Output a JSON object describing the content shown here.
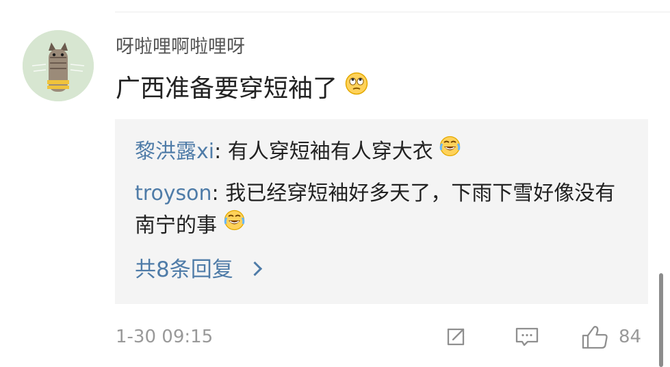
{
  "post": {
    "username": "呀啦哩啊啦哩呀",
    "text": "广西准备要穿短袖了",
    "text_emoji": "rolling-eyes-emoji",
    "timestamp": "1-30 09:15"
  },
  "replies": [
    {
      "user": "黎洪露xi",
      "separator": ": ",
      "text": "有人穿短袖有人穿大衣",
      "emoji": "laughing-tears-emoji"
    },
    {
      "user": "troyson",
      "separator": ": ",
      "text": "我已经穿短袖好多天了，下雨下雪好像没有南宁的事",
      "emoji": "laughing-tears-emoji"
    }
  ],
  "reply_summary": {
    "label": "共8条回复"
  },
  "actions": {
    "share_icon": "share-icon",
    "comment_icon": "comment-icon",
    "like_icon": "thumbs-up-icon",
    "like_count": "84"
  },
  "colors": {
    "link_blue": "#4f7ca8",
    "muted_gray": "#999999",
    "reply_bg": "#f4f4f4"
  }
}
